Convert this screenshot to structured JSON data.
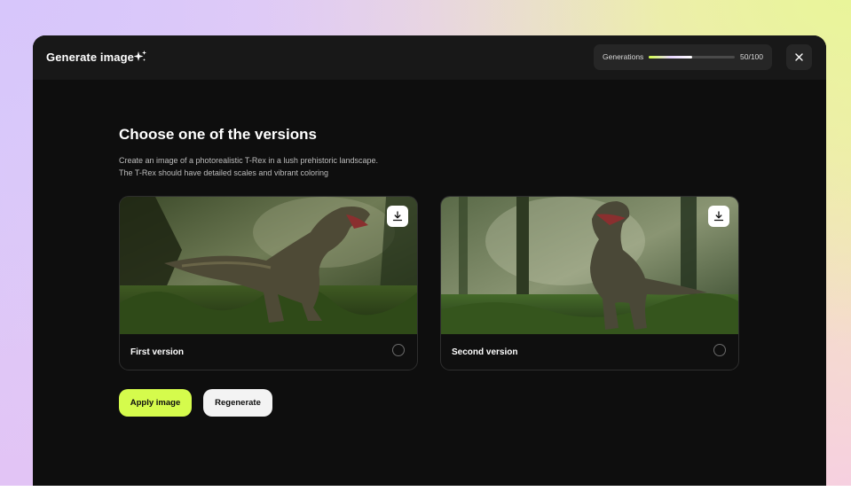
{
  "header": {
    "title": "Generate image",
    "generations_label": "Generations",
    "generations_count": "50/100",
    "generations_progress": 0.5
  },
  "main": {
    "heading": "Choose one of the versions",
    "description_line1": "Create an image of a photorealistic T-Rex in a lush prehistoric landscape.",
    "description_line2": "The T-Rex should have detailed scales and vibrant coloring"
  },
  "versions": [
    {
      "label": "First version",
      "selected": false
    },
    {
      "label": "Second version",
      "selected": false
    }
  ],
  "actions": {
    "apply_label": "Apply image",
    "regenerate_label": "Regenerate"
  },
  "colors": {
    "accent": "#d5fb4c",
    "window_bg": "#0e0e0e",
    "topbar_bg": "#181818"
  },
  "icons": [
    "sparkle-icon",
    "close-icon",
    "download-icon"
  ]
}
